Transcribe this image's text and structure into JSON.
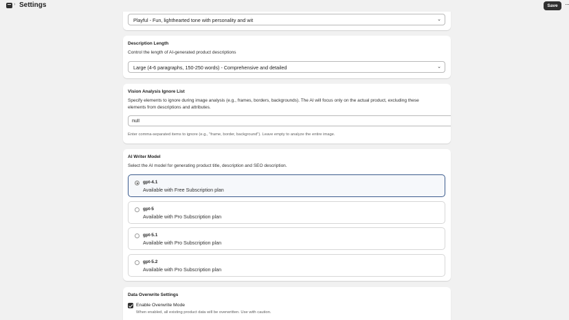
{
  "header": {
    "title": "Settings",
    "save_label": "Save",
    "more_label": "···"
  },
  "tone": {
    "selected": "Playful - Fun, lighthearted tone with personality and wit"
  },
  "description_length": {
    "title": "Description Length",
    "subtitle": "Control the length of AI-generated product descriptions",
    "selected": "Large (4-6 paragraphs, 150-250 words) - Comprehensive and detailed"
  },
  "vision": {
    "title": "Vision Analysis Ignore List",
    "desc_line1": "Specify elements to ignore during image analysis (e.g., frames, borders, backgrounds). The AI will focus only on the actual product, excluding these",
    "desc_line2": "elements from descriptions and attributes.",
    "input_value": "null",
    "help": "Enter comma-separated items to ignore (e.g., \"frame, border, background\"). Leave empty to analyze the entire image."
  },
  "writer": {
    "title": "AI Writer Model",
    "subtitle": "Select the AI model for generating product title, description and SEO description.",
    "models": [
      {
        "name": "gpt-4.1",
        "desc": "Available with Free Subscription plan",
        "selected": true
      },
      {
        "name": "gpt-5",
        "desc": "Available with Pro Subscription plan",
        "selected": false
      },
      {
        "name": "gpt-5.1",
        "desc": "Available with Pro Subscription plan",
        "selected": false
      },
      {
        "name": "gpt-5.2",
        "desc": "Available with Pro Subscription plan",
        "selected": false
      }
    ]
  },
  "overwrite": {
    "title": "Data Overwrite Settings",
    "checkbox_label": "Enable Overwrite Mode",
    "checked": true,
    "help": "When enabled, all existing product data will be overwritten. Use with caution."
  }
}
